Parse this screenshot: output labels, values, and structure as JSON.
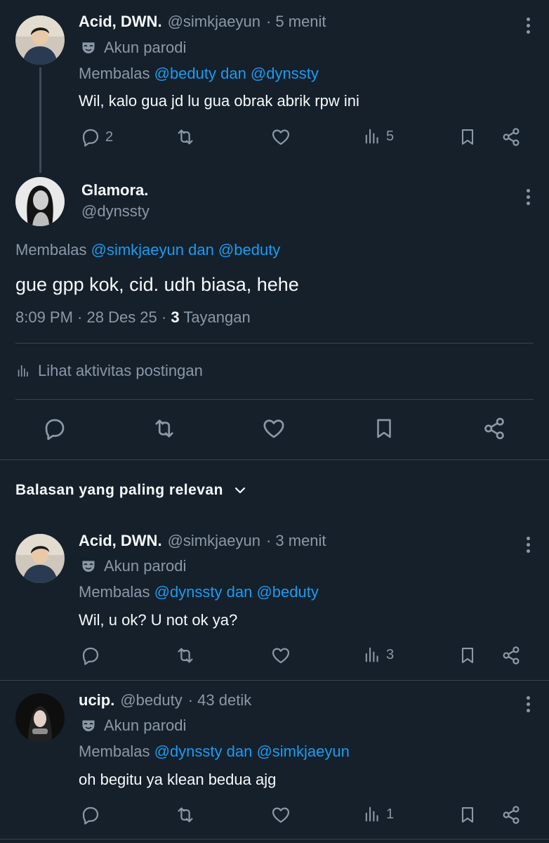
{
  "posts": [
    {
      "name": "Acid, DWN.",
      "handle": "@simkjaeyun",
      "time": "· 5 menit",
      "badge": "Akun parodi",
      "reply_prefix": "Membalas",
      "reply_to": "@beduty dan @dynssty",
      "text": "Wil, kalo gua jd lu gua obrak abrik rpw ini",
      "replies": "2",
      "views": "5"
    },
    {
      "name": "ucip.",
      "handle": "@beduty",
      "time": "· 43 detik",
      "badge": "Akun parodi",
      "reply_prefix": "Membalas",
      "reply_to": "@dynssty dan @simkjaeyun",
      "text": "oh begitu ya klean bedua ajg",
      "views": "1"
    }
  ],
  "main": {
    "name": "Glamora.",
    "handle": "@dynssty",
    "reply_prefix": "Membalas",
    "reply_to": "@simkjaeyun dan @beduty",
    "text": "gue gpp kok, cid. udh biasa, hehe",
    "timestamp": "8:09 PM · 28 Des 25 ·",
    "view_count": "3",
    "view_label": "Tayangan",
    "activity": "Lihat aktivitas postingan"
  },
  "replies_header": "Balasan yang paling relevan",
  "reply1": {
    "name": "Acid, DWN.",
    "handle": "@simkjaeyun",
    "time": "· 3 menit",
    "badge": "Akun parodi",
    "reply_prefix": "Membalas",
    "reply_to": "@dynssty dan @beduty",
    "text": "Wil, u ok? U not ok ya?",
    "views": "3"
  },
  "colors": {
    "background": "#15202b",
    "accent": "#1d9bf0",
    "muted": "#8b98a5",
    "divider": "#38444d"
  }
}
